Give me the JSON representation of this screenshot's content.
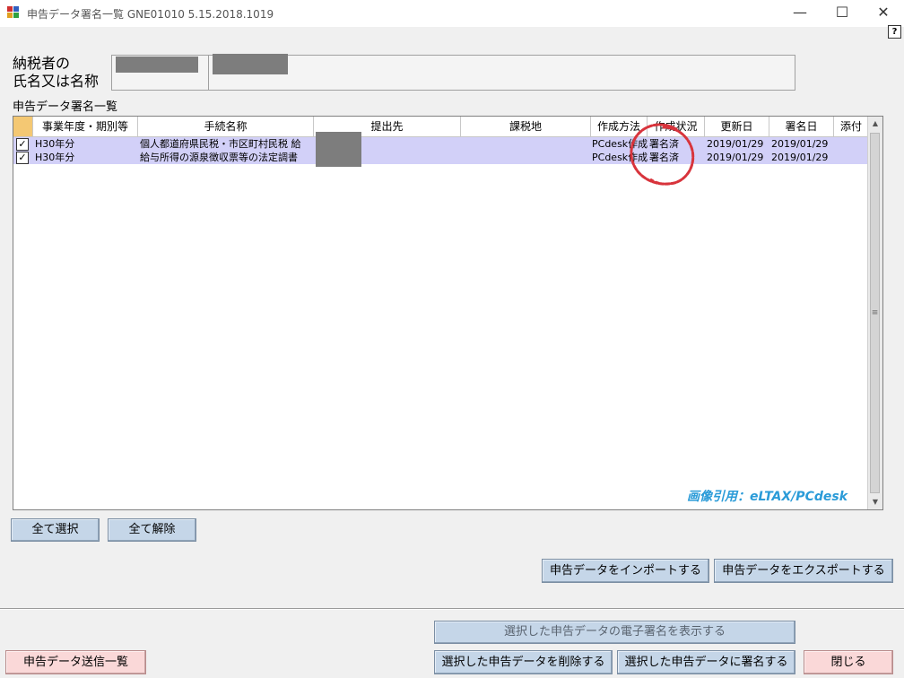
{
  "window": {
    "title": "申告データ署名一覧 GNE01010  5.15.2018.1019",
    "minimize": "—",
    "maximize": "☐",
    "close": "✕",
    "help": "?"
  },
  "taxpayer": {
    "label_line1": "納税者の",
    "label_line2": "氏名又は名称"
  },
  "list": {
    "label": "申告データ署名一覧",
    "columns": [
      "事業年度・期別等",
      "手続名称",
      "提出先",
      "課税地",
      "作成方法",
      "作成状況",
      "更新日",
      "署名日",
      "添付"
    ],
    "rows": [
      {
        "checked": "✓",
        "period": "H30年分",
        "procedure": "個人都道府県民税・市区町村民税  給",
        "method": "PCdesk作成",
        "status": "署名済",
        "updated": "2019/01/29",
        "signed": "2019/01/29"
      },
      {
        "checked": "✓",
        "period": "H30年分",
        "procedure": "給与所得の源泉徴収票等の法定調書",
        "method": "PCdesk作成",
        "status": "署名済",
        "updated": "2019/01/29",
        "signed": "2019/01/29"
      }
    ]
  },
  "watermark": "画像引用：eLTAX/PCdesk",
  "buttons": {
    "select_all": "全て選択",
    "deselect_all": "全て解除",
    "import": "申告データをインポートする",
    "export": "申告データをエクスポートする",
    "show_signature": "選択した申告データの電子署名を表示する",
    "send_list": "申告データ送信一覧",
    "delete": "選択した申告データを削除する",
    "sign": "選択した申告データに署名する",
    "close": "閉じる"
  },
  "colors": {
    "row_selected": "#d2d0f8",
    "button": "#c5d6e8",
    "button_pink": "#fad8d8",
    "stamp": "#d8343c",
    "watermark": "#2a9bd8"
  }
}
